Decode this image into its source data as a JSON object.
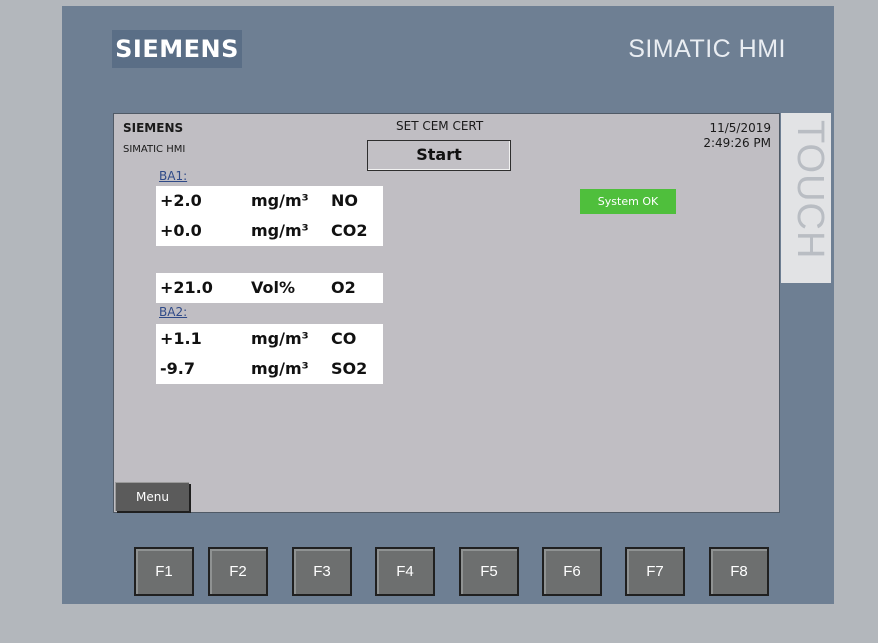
{
  "device": {
    "brand": "SIEMENS",
    "model": "SIMATIC HMI",
    "edge_label": "TOUCH"
  },
  "screen": {
    "brand": "SIEMENS",
    "subtitle": "SIMATIC HMI",
    "title": "SET CEM CERT",
    "start_label": "Start",
    "date": "11/5/2019",
    "time": "2:49:26 PM",
    "status": {
      "label": "System OK",
      "color": "#4fbf3c"
    },
    "menu_label": "Menu",
    "ba1": {
      "label": "BA1:",
      "rows": [
        {
          "value": "+2.0",
          "unit": "mg/m³",
          "gas": "NO"
        },
        {
          "value": "+0.0",
          "unit": "mg/m³",
          "gas": "CO2"
        }
      ]
    },
    "o2": {
      "value": "+21.0",
      "unit": "Vol%",
      "gas": "O2"
    },
    "ba2": {
      "label": "BA2:",
      "rows": [
        {
          "value": "+1.1",
          "unit": "mg/m³",
          "gas": "CO"
        },
        {
          "value": "-9.7",
          "unit": "mg/m³",
          "gas": "SO2"
        }
      ]
    }
  },
  "function_keys": [
    "F1",
    "F2",
    "F3",
    "F4",
    "F5",
    "F6",
    "F7",
    "F8"
  ]
}
